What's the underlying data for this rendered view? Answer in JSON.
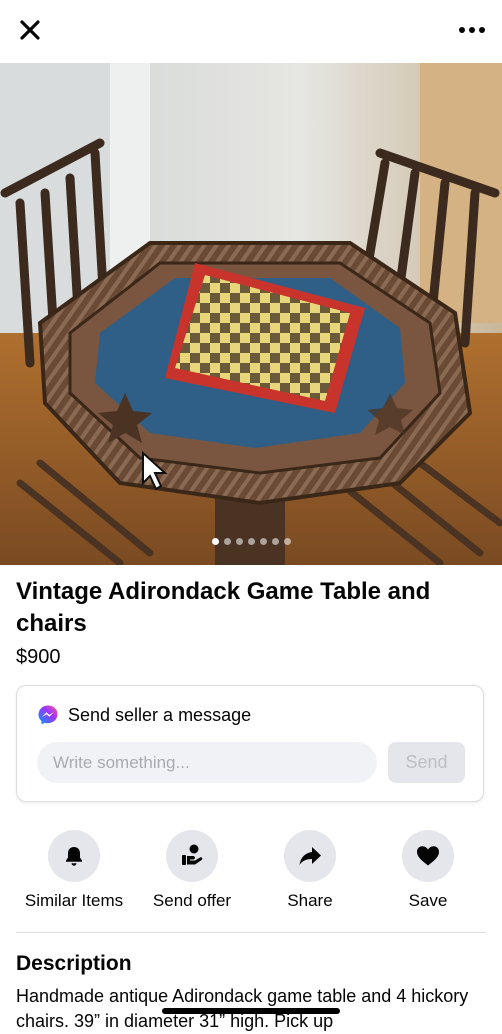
{
  "header": {
    "close_icon": "close-icon",
    "more_icon": "more-horizontal-icon"
  },
  "photo": {
    "alt": "Octagonal twig-frame game table with a red and yellow checkerboard top, flanked by two hickory chairs",
    "image_count": 7,
    "active_index": 0
  },
  "listing": {
    "title": "Vintage Adirondack Game Table and chairs",
    "price": "$900"
  },
  "message": {
    "heading": "Send seller a message",
    "icon": "messenger-icon",
    "input_value": "",
    "input_placeholder": "Write something...",
    "send_label": "Send"
  },
  "actions": [
    {
      "label": "Similar Items",
      "icon": "bell-icon"
    },
    {
      "label": "Send offer",
      "icon": "offer-hand-icon"
    },
    {
      "label": "Share",
      "icon": "share-arrow-icon"
    },
    {
      "label": "Save",
      "icon": "heart-icon"
    }
  ],
  "description": {
    "heading": "Description",
    "text": "Handmade antique Adirondack game table and 4 hickory chairs. 39” in diameter 31” high. Pick up"
  },
  "colors": {
    "background": "#ffffff",
    "action_circle": "#e4e6eb",
    "input_background": "#f0f2f5",
    "send_disabled_text": "#bcc0c4",
    "messenger_gradient_start": "#0099ff",
    "messenger_gradient_end": "#ff5c87"
  }
}
